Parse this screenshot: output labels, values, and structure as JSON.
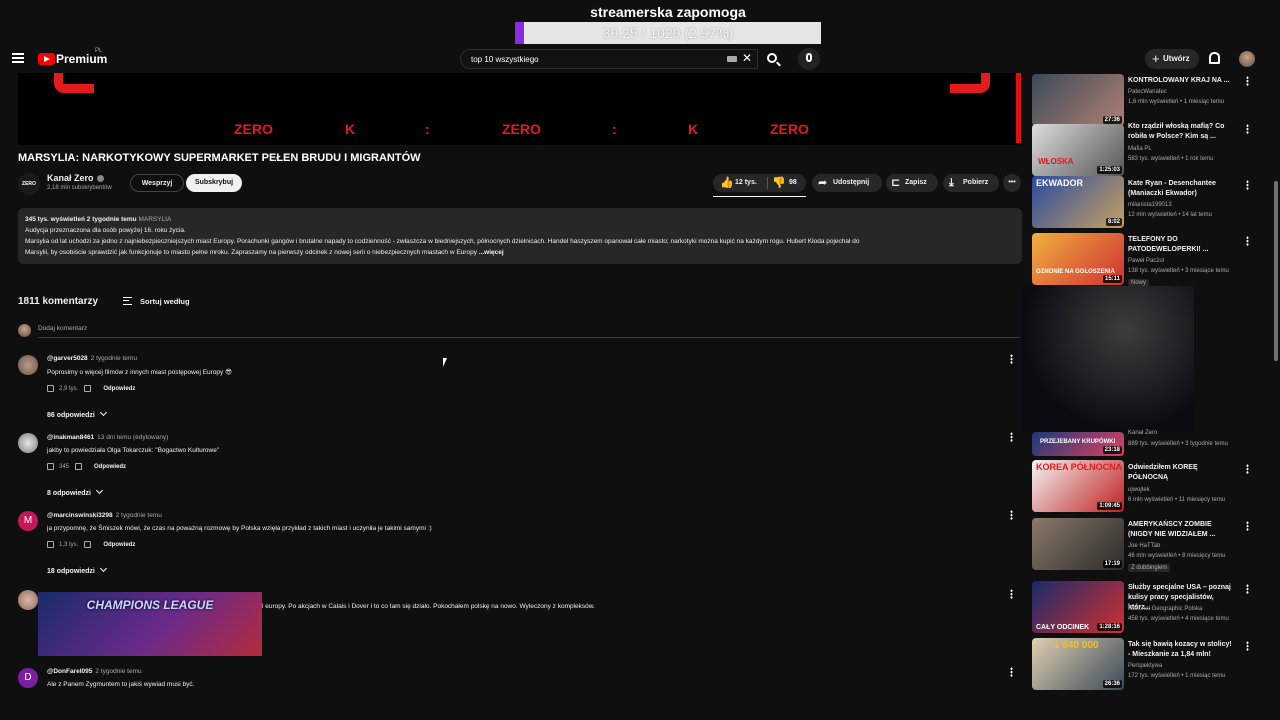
{
  "overlay": {
    "title": "streamerska zapomoga",
    "progress_text": "30.25 / 1020 (2.97%)",
    "progress_fraction": 0.0297,
    "fill_color": "#8a2be2"
  },
  "header": {
    "logo_text": "Premium",
    "region": "PL",
    "search_query": "top 10 wszystkiego",
    "create_label": "Utwórz"
  },
  "player": {
    "overlay_words": [
      "ZERO",
      "K",
      ":",
      "ZERO",
      ":",
      "K",
      "ZERO"
    ],
    "accent": "#e21b1b"
  },
  "video": {
    "title": "MARSYLIA: NARKOTYKOWY SUPERMARKET PEŁEN BRUDU I MIGRANTÓW",
    "channel": {
      "avatar_text": "ZERO",
      "name": "Kanał Zero",
      "subs": "2,18 mln subskrybentów"
    },
    "support_label": "Wesprzyj",
    "subscribe_label": "Subskrybuj",
    "likes": "12 tys.",
    "dislikes": "98",
    "share_label": "Udostępnij",
    "save_label": "Zapisz",
    "download_label": "Pobierz"
  },
  "description": {
    "meta": "345 tys. wyświetleń  2 tygodnie temu",
    "tag": "MARSYLIA",
    "line1": "Audycja przeznaczona dla osób powyżej 16. roku życia.",
    "line2": "Marsylia od lat uchodzi za jedno z najniebezpieczniejszych miast Europy. Porachunki gangów i brutalne napady to codzienność - zwłaszcza w biedniejszych, północnych dzielnicach. Handel haszyszem opanował całe miasto; narkotyki można kupić na każdym rogu. Hubert Kłoda pojechał do",
    "line3": "Marsylii, by osobiście sprawdzić jak funkcjonuje to miasto pełne mroku. Zapraszamy na pierwszy odcinek z nowej serii o niebezpiecznych miastach w Europy",
    "more": "...więcej"
  },
  "comments": {
    "count_label": "1811 komentarzy",
    "sort_label": "Sortuj według",
    "add_placeholder": "Dodaj komentarz",
    "reply_label": "Odpowiedz",
    "items": [
      {
        "author": "@garver5028",
        "time": "2 tygodnie temu",
        "text": "Poprosimy o więcej filmów z innych miast postępowej Europy 😎",
        "likes": "2,9 tys.",
        "replies": "86 odpowiedzi"
      },
      {
        "author": "@inakman8461",
        "time": "13 dni temu (edytowany)",
        "text": "jakby to powiedziała Olga Tokarczuk: \"Bogactwo Kulturowe\"",
        "likes": "345",
        "replies": "8 odpowiedzi"
      },
      {
        "author": "@marcinswinski3298",
        "avatar_letter": "M",
        "time": "2 tygodnie temu",
        "text": "ja przypomnę, że Śmiszek mówi, że czas na poważną rozmowę by Polska wzięła przykład z takich miast i uczyniła je takimi samymi :)",
        "likes": "1,3 tys.",
        "replies": "18 odpowiedzi"
      },
      {
        "text": "l europy. Po akcjach w Calais i Dover i to co tam się działo.  Pokochałem polskę na nowo. Wyleczony z kompleksów."
      },
      {
        "author": "@DonFarel095",
        "avatar_letter": "D",
        "time": "2 tygodnie temu",
        "text": "Ale z Panem Zygmuntem to jakiś wywiad musi być."
      }
    ],
    "overlay_image_text": "CHAMPIONS LEAGUE"
  },
  "sidebar": [
    {
      "title": "KONTROLOWANY KRAJ NA ...",
      "channel": "PatecWariatec",
      "views": "1,6 mln wyświetleń • 1 miesiąc temu",
      "duration": "27:36"
    },
    {
      "title": "Kto rządził włoską mafią? Co robiła w Polsce? Kim są ...",
      "channel": "Mafia PL",
      "views": "583 tys. wyświetleń • 1 rok temu",
      "duration": "1:25:03"
    },
    {
      "title": "Kate Ryan - Desenchantee (Maniaczki Ekwador)",
      "channel": "milanista199013",
      "views": "12 mln wyświetleń • 14 lat temu",
      "duration": "8:02"
    },
    {
      "title": "TELEFONY DO PATODEWELOPERKI! ...",
      "channel": "Paweł Pacżul",
      "views": "138 tys. wyświetleń • 3 miesiące temu",
      "duration": "15:11",
      "badge": "Nowy"
    },
    {
      "channel": "Kanał Zero",
      "views": "889 tys. wyświetleń • 3 tygodnie temu",
      "duration": "23:18"
    },
    {
      "title": "Odwiedziłem KOREĘ PÓŁNOCNĄ",
      "channel": "ojwojtek",
      "views": "6 mln wyświetleń • 11 miesięcy temu",
      "duration": "1:09:45"
    },
    {
      "title": "AMERYKAŃSCY ZOMBIE (NIGDY NIE WIDZIAŁEM ...",
      "channel": "Joe HaTTab",
      "views": "46 mln wyświetleń • 8 miesięcy temu",
      "duration": "17:19",
      "badge": "Z dubbingiem"
    },
    {
      "title": "Służby specjalne USA – poznaj kulisy pracy specjalistów, którz...",
      "channel": "National Geographic Polska",
      "views": "458 tys. wyświetleń • 4 miesiące temu",
      "duration": "1:28:16"
    },
    {
      "title": "Tak się bawią kozacy w stolicy! - Mieszkanie za 1,84 mln!",
      "channel": "Perspektywa",
      "views": "172 tys. wyświetleń • 1 miesiąc temu",
      "duration": "26:36"
    }
  ],
  "thumb_texts": {
    "t2": "WŁOSKA",
    "t3": "EKWADOR",
    "t4": "OZNONIE NA OGŁOSZENIA",
    "t5": "PRZEJEBANY KRUPÓWKI",
    "t6": "KOREA PÓŁNOCNA",
    "t8": "CAŁY ODCINEK",
    "t9": "1 840 000"
  }
}
